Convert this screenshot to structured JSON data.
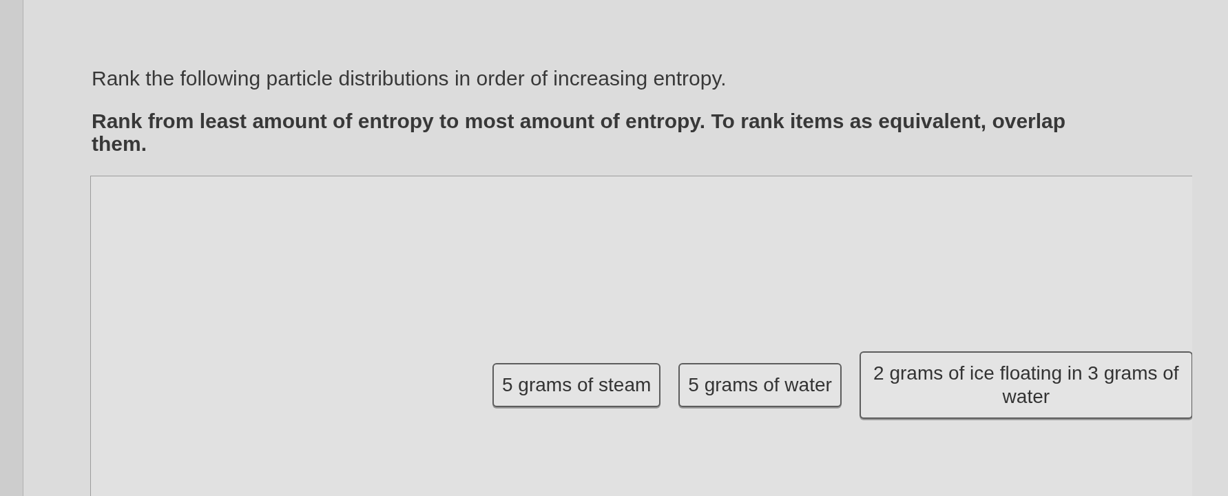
{
  "question": {
    "prompt": "Rank the following particle distributions in order of increasing entropy.",
    "instruction": "Rank from least amount of entropy to most amount of entropy. To rank items as equivalent, overlap them."
  },
  "ranking_area": {
    "items": [
      {
        "label": "5 grams of steam"
      },
      {
        "label": "5 grams of water"
      },
      {
        "label": "2 grams of ice floating in 3 grams of water"
      }
    ]
  }
}
